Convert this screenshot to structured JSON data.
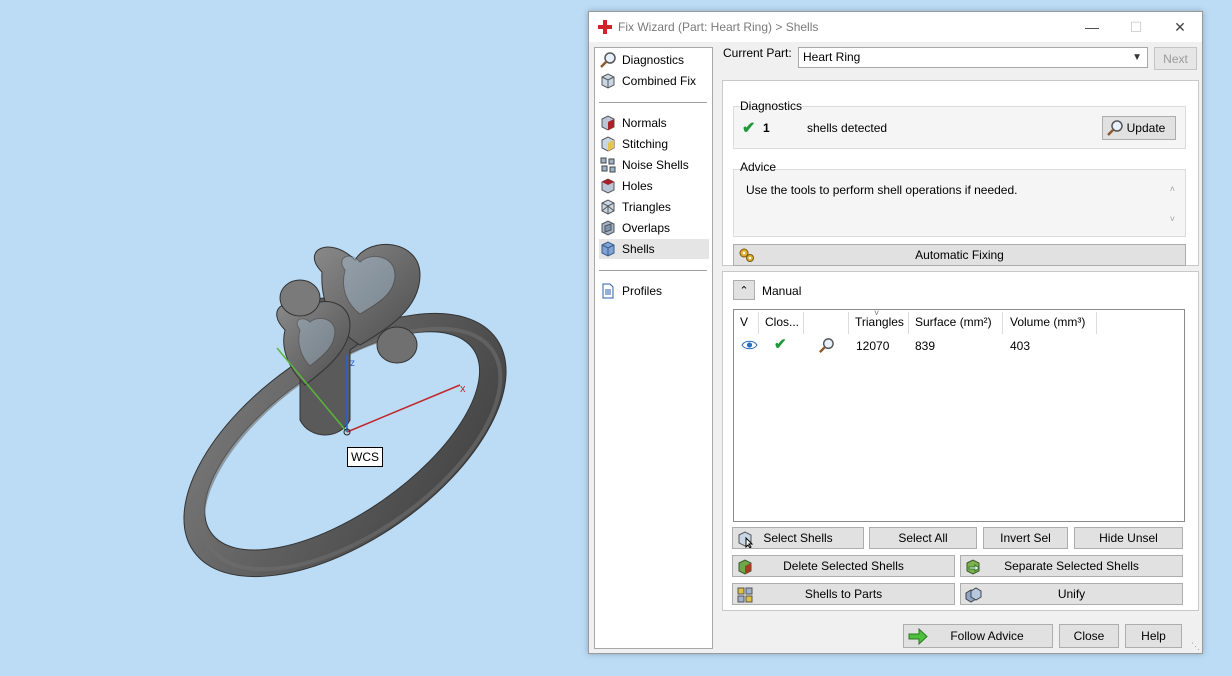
{
  "viewport": {
    "wcs_label": "WCS",
    "axis_x": "x",
    "axis_z": "z"
  },
  "window": {
    "title": "Fix Wizard (Part: Heart Ring) > Shells",
    "controls": {
      "minimize": "—",
      "maximize": "☐",
      "close": "✕"
    }
  },
  "nav": {
    "top": [
      {
        "label": "Diagnostics",
        "icon": "magnifier-icon"
      },
      {
        "label": "Combined Fix",
        "icon": "cube-icon"
      }
    ],
    "tools": [
      {
        "label": "Normals",
        "icon": "normals-cube-icon"
      },
      {
        "label": "Stitching",
        "icon": "stitching-cube-icon"
      },
      {
        "label": "Noise Shells",
        "icon": "noise-shells-icon"
      },
      {
        "label": "Holes",
        "icon": "holes-cube-icon"
      },
      {
        "label": "Triangles",
        "icon": "triangles-cube-icon"
      },
      {
        "label": "Overlaps",
        "icon": "overlaps-cube-icon"
      },
      {
        "label": "Shells",
        "icon": "shells-cube-icon",
        "selected": true
      }
    ],
    "bottom": [
      {
        "label": "Profiles",
        "icon": "document-icon"
      }
    ]
  },
  "current_part": {
    "label": "Current Part:",
    "value": "Heart Ring",
    "next": "Next"
  },
  "diagnostics": {
    "title": "Diagnostics",
    "count": "1",
    "text": "shells detected",
    "update": "Update"
  },
  "advice": {
    "title": "Advice",
    "text": "Use the tools to perform shell operations if needed."
  },
  "automatic_fixing": "Automatic Fixing",
  "manual": {
    "label": "Manual",
    "columns": [
      "V",
      "Clos...",
      "",
      "Triangles",
      "Surface (mm²)",
      "Volume (mm³)"
    ],
    "rows": [
      {
        "triangles": "12070",
        "surface": "839",
        "volume": "403"
      }
    ],
    "buttons": {
      "select_shells": "Select Shells",
      "select_all": "Select All",
      "invert_sel": "Invert Sel",
      "hide_unsel": "Hide Unsel",
      "delete_selected": "Delete Selected Shells",
      "separate_selected": "Separate Selected Shells",
      "shells_to_parts": "Shells to Parts",
      "unify": "Unify"
    }
  },
  "footer": {
    "follow_advice": "Follow Advice",
    "close": "Close",
    "help": "Help"
  },
  "colors": {
    "background": "#bcdcf6",
    "check": "#1f9a3a",
    "axis_x": "#c0272d",
    "axis_y": "#5ab53a",
    "axis_z": "#2b5fd9"
  }
}
